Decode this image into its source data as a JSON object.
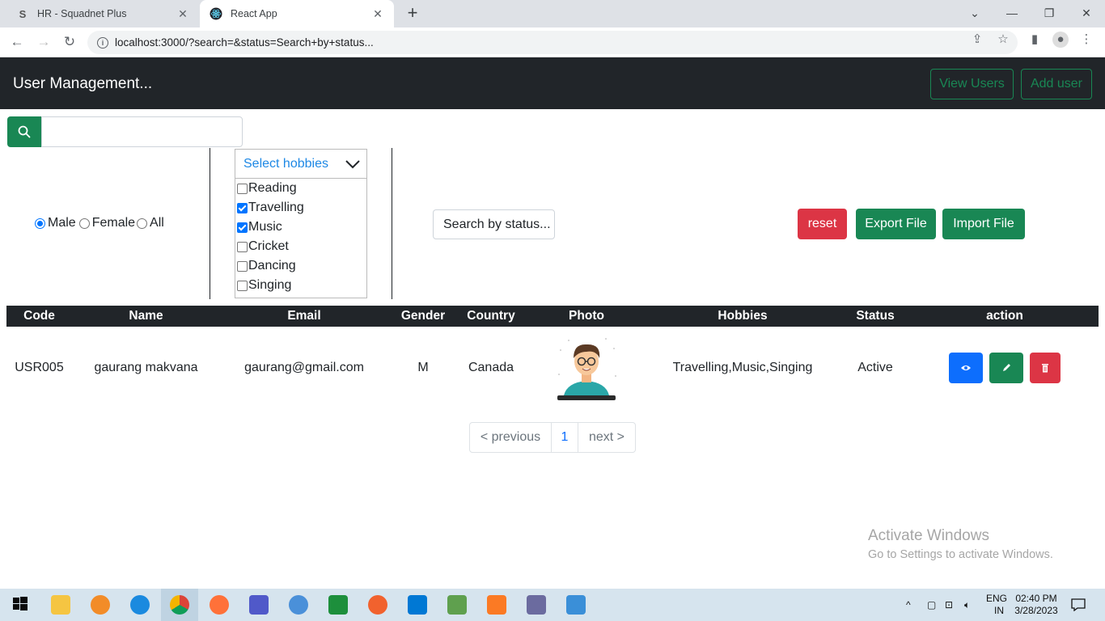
{
  "browser": {
    "tabs": [
      {
        "title": "HR - Squadnet Plus",
        "favicon": "S"
      },
      {
        "title": "React App",
        "favicon": "react-icon"
      }
    ],
    "url": "localhost:3000/?search=&status=Search+by+status..."
  },
  "app": {
    "brand": "User Management...",
    "nav": {
      "view_users": "View Users",
      "add_user": "Add user"
    }
  },
  "filters": {
    "search_placeholder": "",
    "gender_options": [
      "Male",
      "Female",
      "All"
    ],
    "gender_selected": "Male",
    "hobbies": {
      "placeholder": "Select hobbies",
      "options": [
        {
          "label": "Reading",
          "checked": false
        },
        {
          "label": "Travelling",
          "checked": true
        },
        {
          "label": "Music",
          "checked": true
        },
        {
          "label": "Cricket",
          "checked": false
        },
        {
          "label": "Dancing",
          "checked": false
        },
        {
          "label": "Singing",
          "checked": false
        }
      ]
    },
    "status_placeholder": "Search by status...",
    "buttons": {
      "reset": "reset",
      "export": "Export File",
      "import": "Import File"
    }
  },
  "table": {
    "headers": [
      "Code",
      "Name",
      "Email",
      "Gender",
      "Country",
      "Photo",
      "Hobbies",
      "Status",
      "action"
    ],
    "rows": [
      {
        "code": "USR005",
        "name": "gaurang makvana",
        "email": "gaurang@gmail.com",
        "gender": "M",
        "country": "Canada",
        "photo": "avatar",
        "hobbies": "Travelling,Music,Singing",
        "status": "Active"
      }
    ]
  },
  "pagination": {
    "previous": "< previous",
    "current": "1",
    "next": "next >"
  },
  "watermark": {
    "line1": "Activate Windows",
    "line2": "Go to Settings to activate Windows."
  },
  "taskbar": {
    "lang": "ENG",
    "region": "IN",
    "time": "02:40 PM",
    "date": "3/28/2023"
  },
  "colors": {
    "success": "#198754",
    "danger": "#dc3545",
    "primary": "#0d6efd",
    "dark": "#212529"
  }
}
